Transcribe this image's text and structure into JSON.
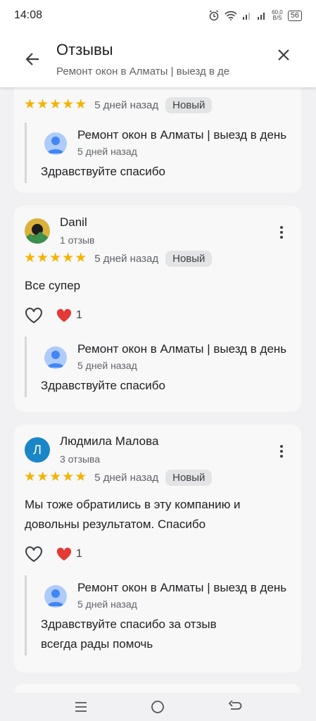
{
  "status": {
    "time": "14:08",
    "net_speed_top": "60,0",
    "net_speed_unit": "B/S",
    "battery": "56"
  },
  "header": {
    "title": "Отзывы",
    "subtitle": "Ремонт окон в Алматы | выезд в де"
  },
  "rating_labels": {
    "new_badge": "Новый"
  },
  "reviews": [
    {
      "rating": 5,
      "date": "5 дней назад",
      "reply": {
        "owner": "Ремонт окон в Алматы | выезд в день",
        "date": "5 дней назад",
        "text": "Здравствуйте спасибо"
      }
    },
    {
      "author": "Danil",
      "count": "1 отзыв",
      "rating": 5,
      "date": "5 дней назад",
      "text": "Все супер",
      "likes": "1",
      "reply": {
        "owner": "Ремонт окон в Алматы | выезд в день",
        "date": "5 дней назад",
        "text": "Здравствуйте спасибо"
      }
    },
    {
      "author": "Людмила Малова",
      "avatar_letter": "Л",
      "count": "3 отзыва",
      "rating": 5,
      "date": "5 дней назад",
      "text": "Мы тоже обратились в эту компанию и довольны результатом. Спасибо",
      "likes": "1",
      "reply": {
        "owner": "Ремонт окон в Алматы | выезд в день",
        "date": "5 дней назад",
        "text": "Здравствуйте спасибо за отзыв всегда рады помочь"
      }
    }
  ],
  "colors": {
    "star": "#f4b400",
    "heart": "#e53935",
    "letter_avatar": "#1a86c7"
  },
  "icons": {
    "back": "arrow-left-icon",
    "close": "close-icon",
    "more": "more-vert-icon",
    "like": "heart-outline-icon",
    "reaction": "red-heart-icon",
    "nav_recents": "menu-icon",
    "nav_home": "circle-icon",
    "nav_back": "back-icon"
  }
}
